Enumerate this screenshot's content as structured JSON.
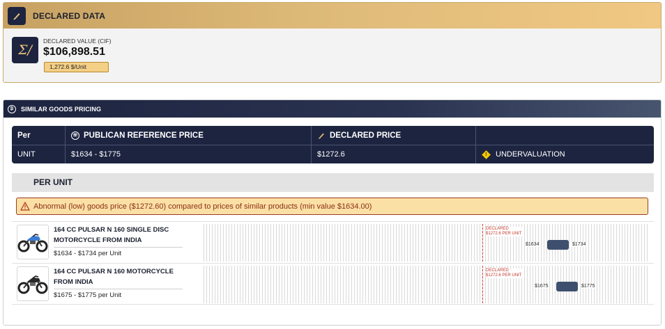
{
  "declared": {
    "header_title": "DECLARED DATA",
    "value_label": "DECLARED VALUE (CIF)",
    "value": "$106,898.51",
    "unit_price": "1,272.6 $/Unit",
    "icons": {
      "header": "pen-icon",
      "value": "sigma-icon"
    }
  },
  "similar": {
    "header_title": "SIMILAR GOODS PRICING",
    "table": {
      "headers": [
        "Per",
        "PUBLICAN REFERENCE PRICE",
        "DECLARED PRICE",
        ""
      ],
      "row": [
        "UNIT",
        "$1634 - $1775",
        "$1272.6",
        "UNDERVALUATION"
      ]
    },
    "section_title": "PER UNIT",
    "alert": "Abnormal (low) goods price ($1272.60) compared to prices of similar products (min value $1634.00)",
    "products": [
      {
        "name": "164 CC PULSAR N 160 SINGLE DISC MOTORCYCLE FROM INDIA",
        "range_text": "$1634 - $1734 per Unit",
        "declared_marker": [
          "DECLARED",
          "$1272.6 PER UNIT"
        ],
        "min_label": "$1634",
        "max_label": "$1734"
      },
      {
        "name": "164 CC PULSAR N 160 MOTORCYCLE FROM INDIA",
        "range_text": "$1675 - $1775 per Unit",
        "declared_marker": [
          "DECLARED",
          "$1272.6 PER UNIT"
        ],
        "min_label": "$1675",
        "max_label": "$1775"
      }
    ]
  },
  "colors": {
    "navy": "#1d2440",
    "gold": "#e8c07a",
    "alert_bg": "#fbe0a5",
    "alert_border": "#9a3c20",
    "declared_marker": "#d23a2a",
    "range_box": "#3e4f6e"
  }
}
